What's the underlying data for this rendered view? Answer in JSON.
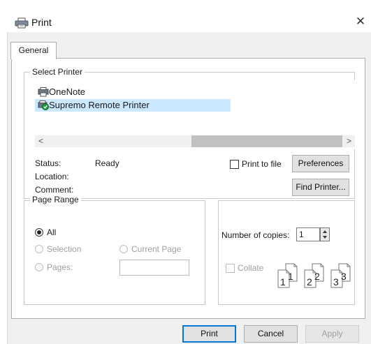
{
  "window": {
    "title": "Print",
    "icon": "printer-icon",
    "close_glyph": "✕"
  },
  "tabs": [
    {
      "label": "General",
      "active": true
    }
  ],
  "select_printer": {
    "legend": "Select Printer",
    "printers": [
      {
        "name": "OneNote",
        "icon": "onenote-printer-icon",
        "selected": false
      },
      {
        "name": "Supremo Remote Printer",
        "icon": "supremo-printer-icon",
        "selected": true
      }
    ],
    "scroll_left_glyph": "<",
    "scroll_right_glyph": ">",
    "status_label": "Status:",
    "status_value": "Ready",
    "location_label": "Location:",
    "comment_label": "Comment:",
    "print_to_file_label": "Print to file",
    "print_to_file_checked": false,
    "preferences_label": "Preferences",
    "find_printer_label": "Find Printer..."
  },
  "page_range": {
    "legend": "Page Range",
    "options": {
      "all": "All",
      "selection": "Selection",
      "current_page": "Current Page",
      "pages": "Pages:"
    },
    "selected": "all",
    "pages_value": ""
  },
  "copies": {
    "label": "Number of copies:",
    "value": "1",
    "collate_label": "Collate",
    "collate_checked": false,
    "collate_pages": [
      "1",
      "1",
      "2",
      "2",
      "3",
      "3"
    ]
  },
  "footer": {
    "print_label": "Print",
    "cancel_label": "Cancel",
    "apply_label": "Apply"
  },
  "colors": {
    "selection": "#cce8ff",
    "default_button_border": "#0078d7",
    "disabled_text": "#a0a0a0"
  }
}
